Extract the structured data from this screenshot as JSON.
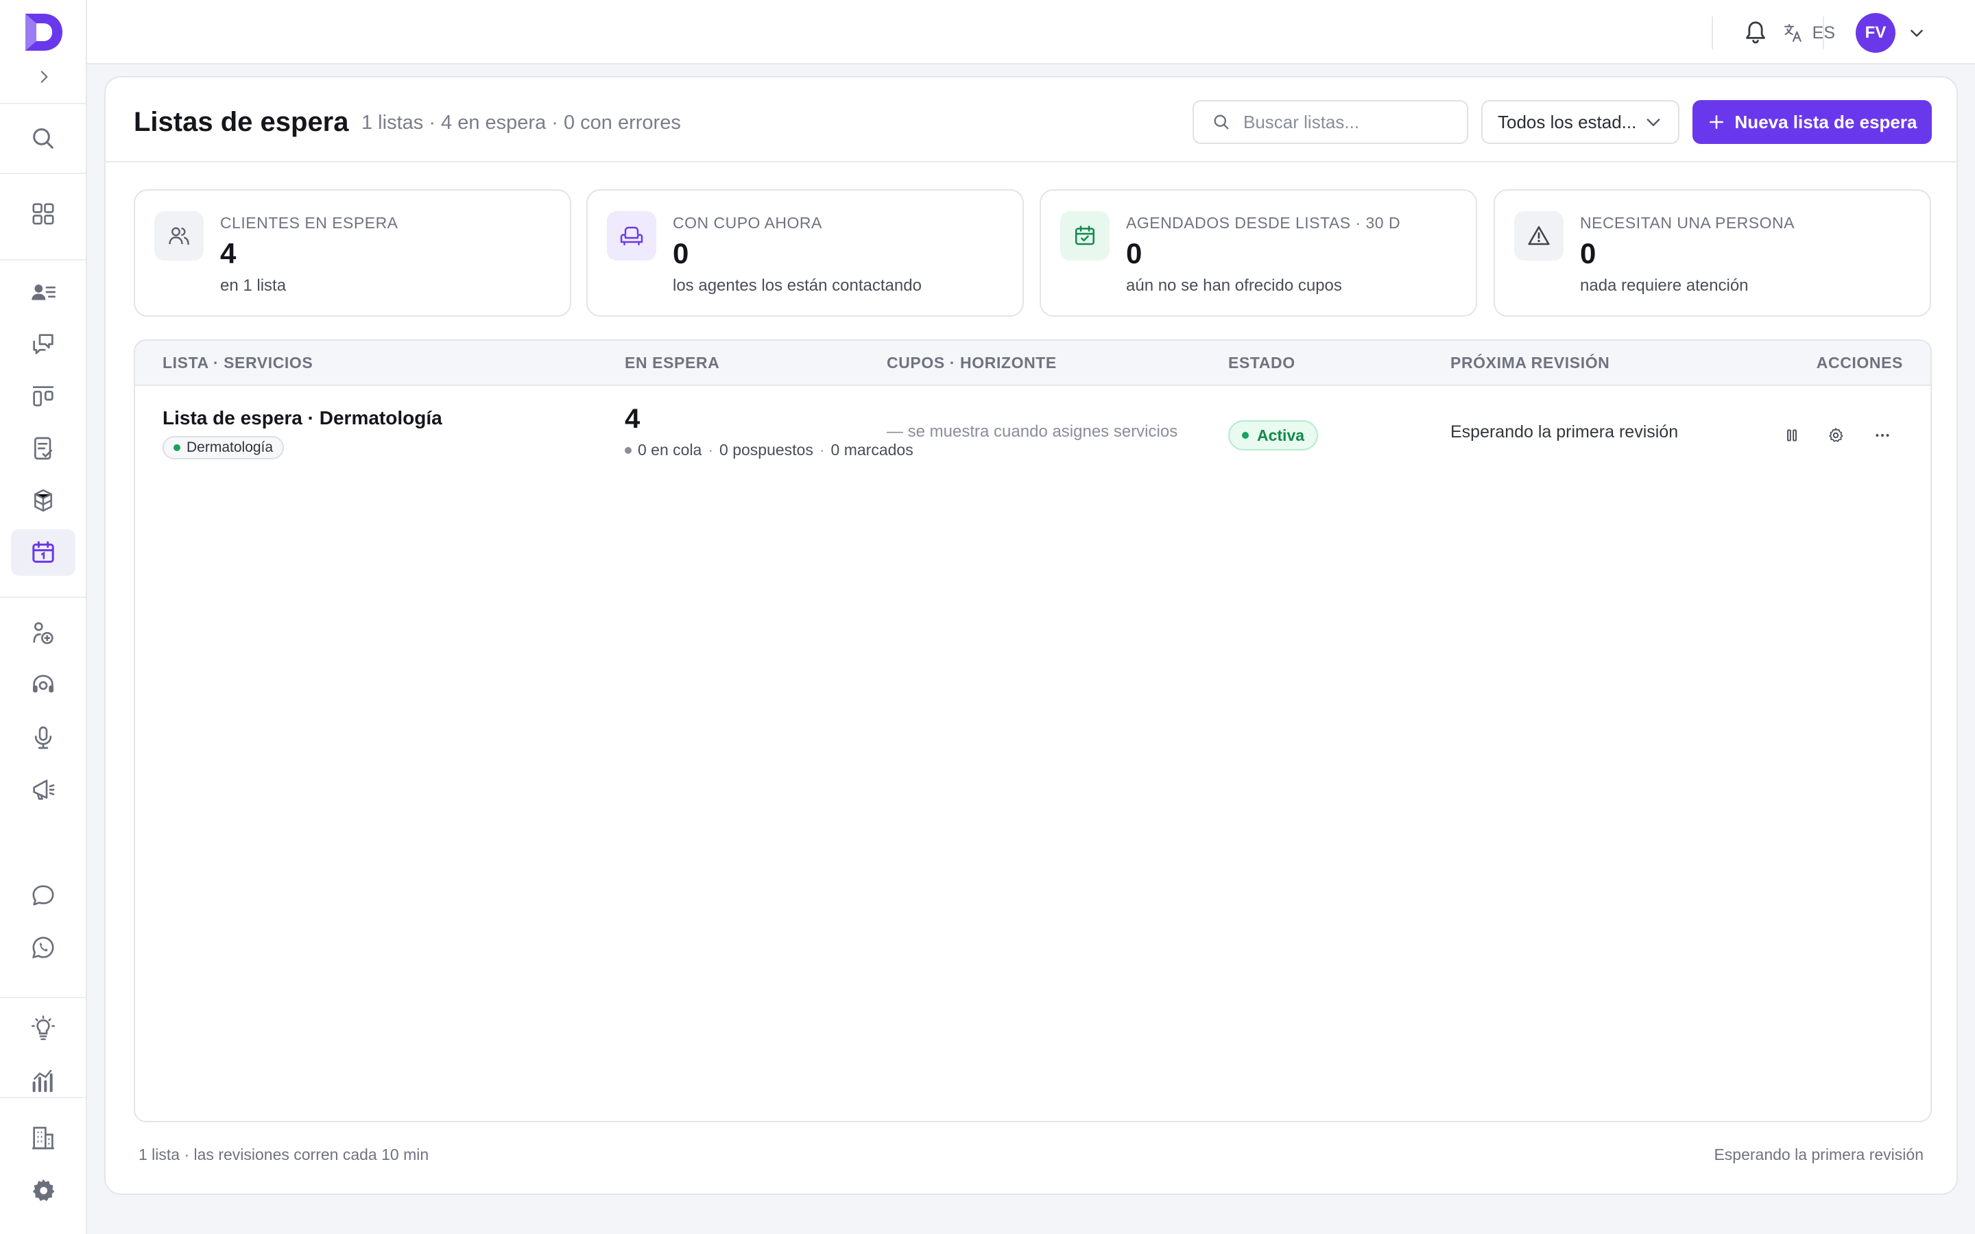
{
  "app": {
    "colors": {
      "brand": "#6a38ec",
      "success": "#138a4c",
      "text_muted": "#7a7e89"
    }
  },
  "sidebar": {
    "items": [
      {
        "icon": "search-icon"
      },
      {
        "icon": "grid-icon"
      },
      {
        "icon": "contacts-icon"
      },
      {
        "icon": "chat-bubbles-icon"
      },
      {
        "icon": "kanban-icon"
      },
      {
        "icon": "checklist-icon"
      },
      {
        "icon": "boxes-icon"
      },
      {
        "icon": "calendar-icon",
        "active": true
      },
      {
        "icon": "services-icon"
      },
      {
        "icon": "support-agent-icon"
      },
      {
        "icon": "microphone-icon"
      },
      {
        "icon": "megaphone-icon"
      },
      {
        "icon": "message-icon"
      },
      {
        "icon": "whatsapp-icon"
      },
      {
        "icon": "lightbulb-icon"
      },
      {
        "icon": "analytics-icon"
      },
      {
        "icon": "building-icon"
      },
      {
        "icon": "settings-icon"
      }
    ]
  },
  "topbar": {
    "language": "ES",
    "user_initials": "FV"
  },
  "header": {
    "title": "Listas de espera",
    "subtitle": "1 listas · 4 en espera · 0 con errores",
    "search_placeholder": "Buscar listas...",
    "filter_value": "Todos los estad...",
    "new_button": "Nueva lista de espera"
  },
  "stats": [
    {
      "label": "CLIENTES EN ESPERA",
      "value": "4",
      "note": "en 1 lista",
      "icon": "users-icon",
      "color": "#5b5f6b"
    },
    {
      "label": "CON CUPO AHORA",
      "value": "0",
      "note": "los agentes los están contactando",
      "icon": "armchair-icon",
      "color": "#6a38ec"
    },
    {
      "label": "AGENDADOS DESDE LISTAS · 30 D",
      "value": "0",
      "note": "aún no se han ofrecido cupos",
      "icon": "calendar-check-icon",
      "color": "#138a4c"
    },
    {
      "label": "NECESITAN UNA PERSONA",
      "value": "0",
      "note": "nada requiere atención",
      "icon": "warning-icon",
      "color": "#5b5f6b"
    }
  ],
  "table": {
    "columns": [
      "LISTA · SERVICIOS",
      "EN ESPERA",
      "CUPOS · HORIZONTE",
      "ESTADO",
      "PRÓXIMA REVISIÓN",
      "ACCIONES"
    ],
    "rows": [
      {
        "name": "Lista de espera · Dermatología",
        "tag": "Dermatología",
        "waiting": "4",
        "queue": "0 en cola",
        "postponed": "0 pospuestos",
        "marked": "0 marcados",
        "slots": "— se muestra cuando asignes servicios",
        "status": "Activa",
        "next_review": "Esperando la primera revisión"
      }
    ]
  },
  "footer": {
    "left": "1 lista · las revisiones corren cada 10 min",
    "right": "Esperando la primera revisión"
  }
}
